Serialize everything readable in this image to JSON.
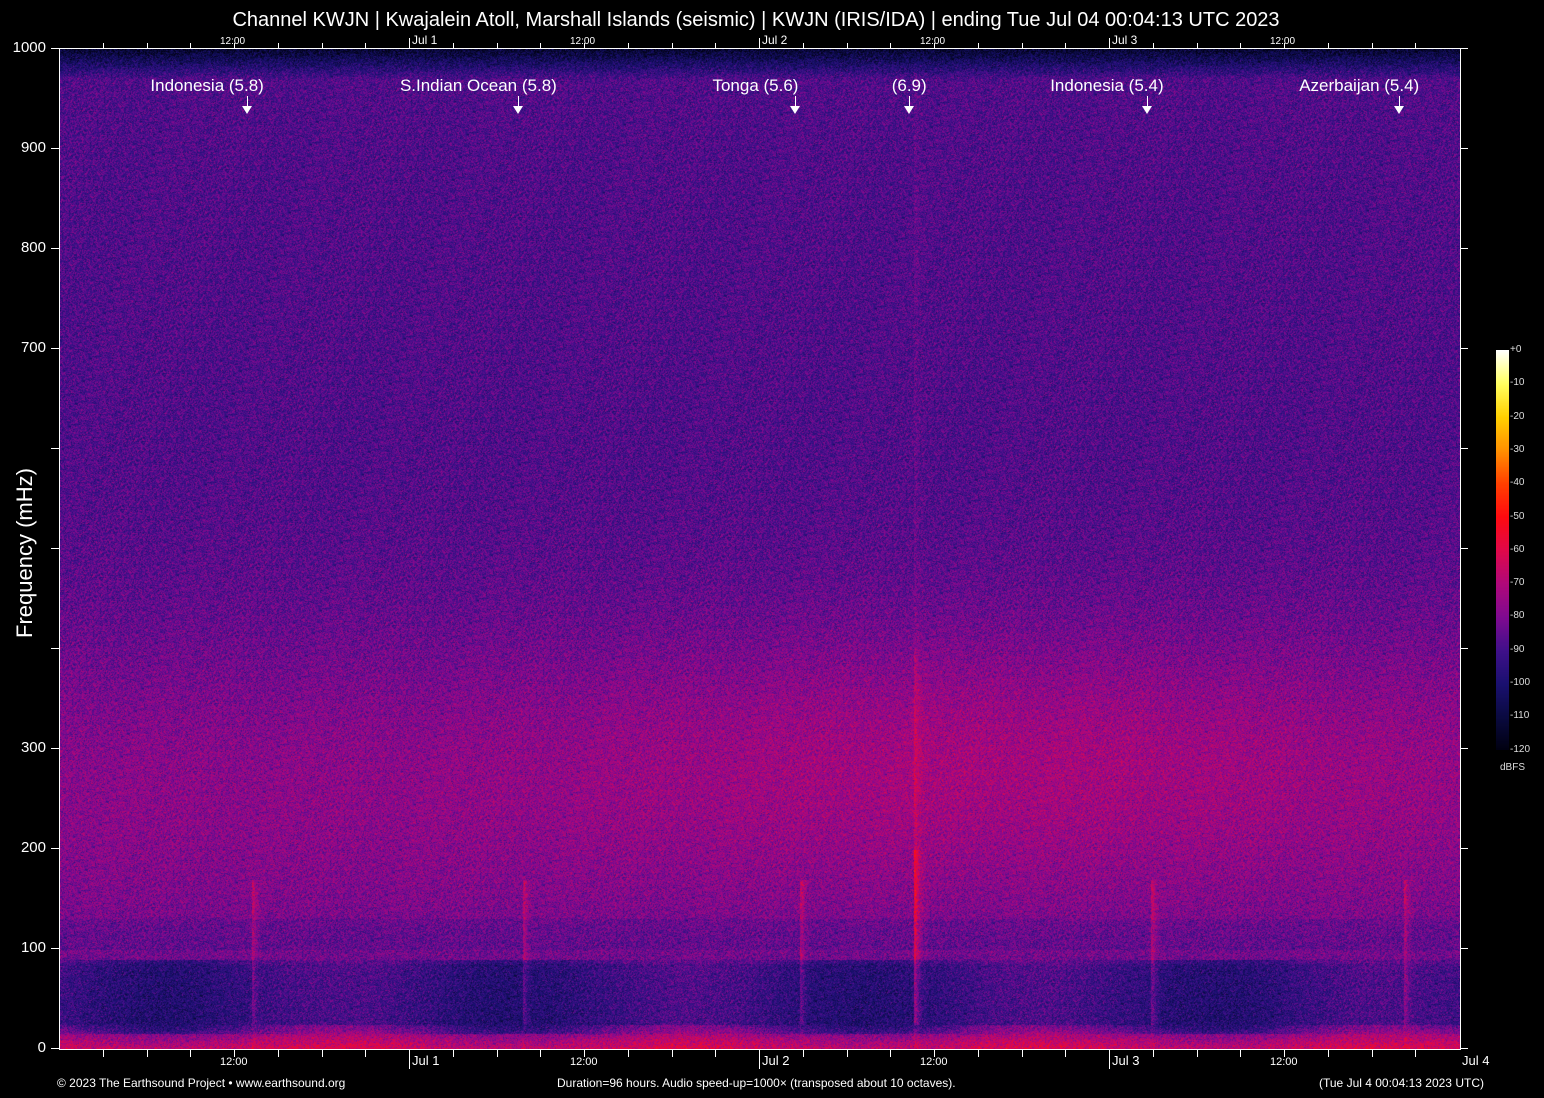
{
  "chart_data": {
    "type": "heatmap",
    "title": "Channel KWJN | Kwajalein Atoll, Marshall Islands (seismic) | KWJN (IRIS/IDA) | ending Tue Jul 04 00:04:13 UTC 2023",
    "ylabel": "Frequency (mHz)",
    "ylim": [
      0,
      1000
    ],
    "yticks": [
      0,
      100,
      200,
      300,
      400,
      500,
      600,
      700,
      800,
      900,
      1000
    ],
    "ytick_labels": [
      "0",
      "100",
      "200",
      "300",
      "",
      "",
      "",
      "700",
      "800",
      "900",
      "1000"
    ],
    "x_duration_hours": 96,
    "xticks": [
      {
        "hour": 12,
        "label": "12:00"
      },
      {
        "hour": 24,
        "label": "Jul  1",
        "day": true
      },
      {
        "hour": 36,
        "label": "12:00"
      },
      {
        "hour": 48,
        "label": "Jul  2",
        "day": true
      },
      {
        "hour": 60,
        "label": "12:00"
      },
      {
        "hour": 72,
        "label": "Jul  3",
        "day": true
      },
      {
        "hour": 84,
        "label": "12:00"
      },
      {
        "hour": 96,
        "label": "Jul  4",
        "day": true
      }
    ],
    "events": [
      {
        "label": "Indonesia (5.8)",
        "hour": 12.9
      },
      {
        "label": "S.Indian Ocean (5.8)",
        "hour": 31.5
      },
      {
        "label": "Tonga (5.6)",
        "hour": 50.5
      },
      {
        "label": "(6.9)",
        "hour": 58.3
      },
      {
        "label": "Indonesia (5.4)",
        "hour": 74.6
      },
      {
        "label": "Azerbaijan (5.4)",
        "hour": 91.9
      }
    ],
    "colorbar": {
      "label": "dBFS",
      "range": [
        -120,
        0
      ],
      "ticks": [
        "+0",
        "-10",
        "-20",
        "-30",
        "-40",
        "-50",
        "-60",
        "-70",
        "-80",
        "-90",
        "-100",
        "-110",
        "-120"
      ]
    }
  },
  "footer": {
    "left": "© 2023 The Earthsound Project • www.earthsound.org",
    "center": "Duration=96 hours. Audio speed-up=1000× (transposed about 10 octaves).",
    "right": "(Tue Jul  4 00:04:13 2023 UTC)"
  }
}
